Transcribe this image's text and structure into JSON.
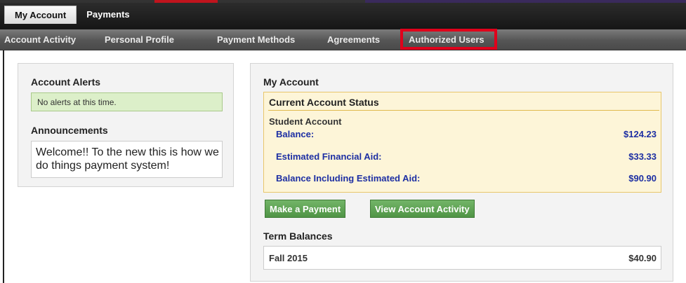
{
  "top_tabs": [
    {
      "label": "My Account",
      "active": true
    },
    {
      "label": "Payments",
      "active": false
    }
  ],
  "sub_nav": [
    {
      "label": "Account Activity"
    },
    {
      "label": "Personal Profile"
    },
    {
      "label": "Payment Methods"
    },
    {
      "label": "Agreements"
    },
    {
      "label": "Authorized Users",
      "highlighted": true
    }
  ],
  "left_panel": {
    "alerts_heading": "Account Alerts",
    "alert_message": "No alerts at this time.",
    "announcements_heading": "Announcements",
    "announcement_text": "Welcome!! To the new this is how we do things payment system!"
  },
  "my_account": {
    "heading": "My Account",
    "status_title": "Current Account Status",
    "account_type": "Student Account",
    "rows": [
      {
        "label": "Balance:",
        "value": "$124.23"
      },
      {
        "label": "Estimated Financial Aid:",
        "value": "$33.33"
      },
      {
        "label": "Balance Including Estimated Aid:",
        "value": "$90.90"
      }
    ],
    "make_payment_label": "Make a Payment",
    "view_activity_label": "View Account Activity",
    "term_heading": "Term Balances",
    "terms": [
      {
        "name": "Fall 2015",
        "amount": "$40.90"
      }
    ]
  },
  "colors": {
    "highlight_border": "#e0001b",
    "link_blue": "#1d2fa3",
    "button_green": "#5a9e4f",
    "alert_green": "#dcefc9",
    "status_bg": "#fdf5d8"
  }
}
